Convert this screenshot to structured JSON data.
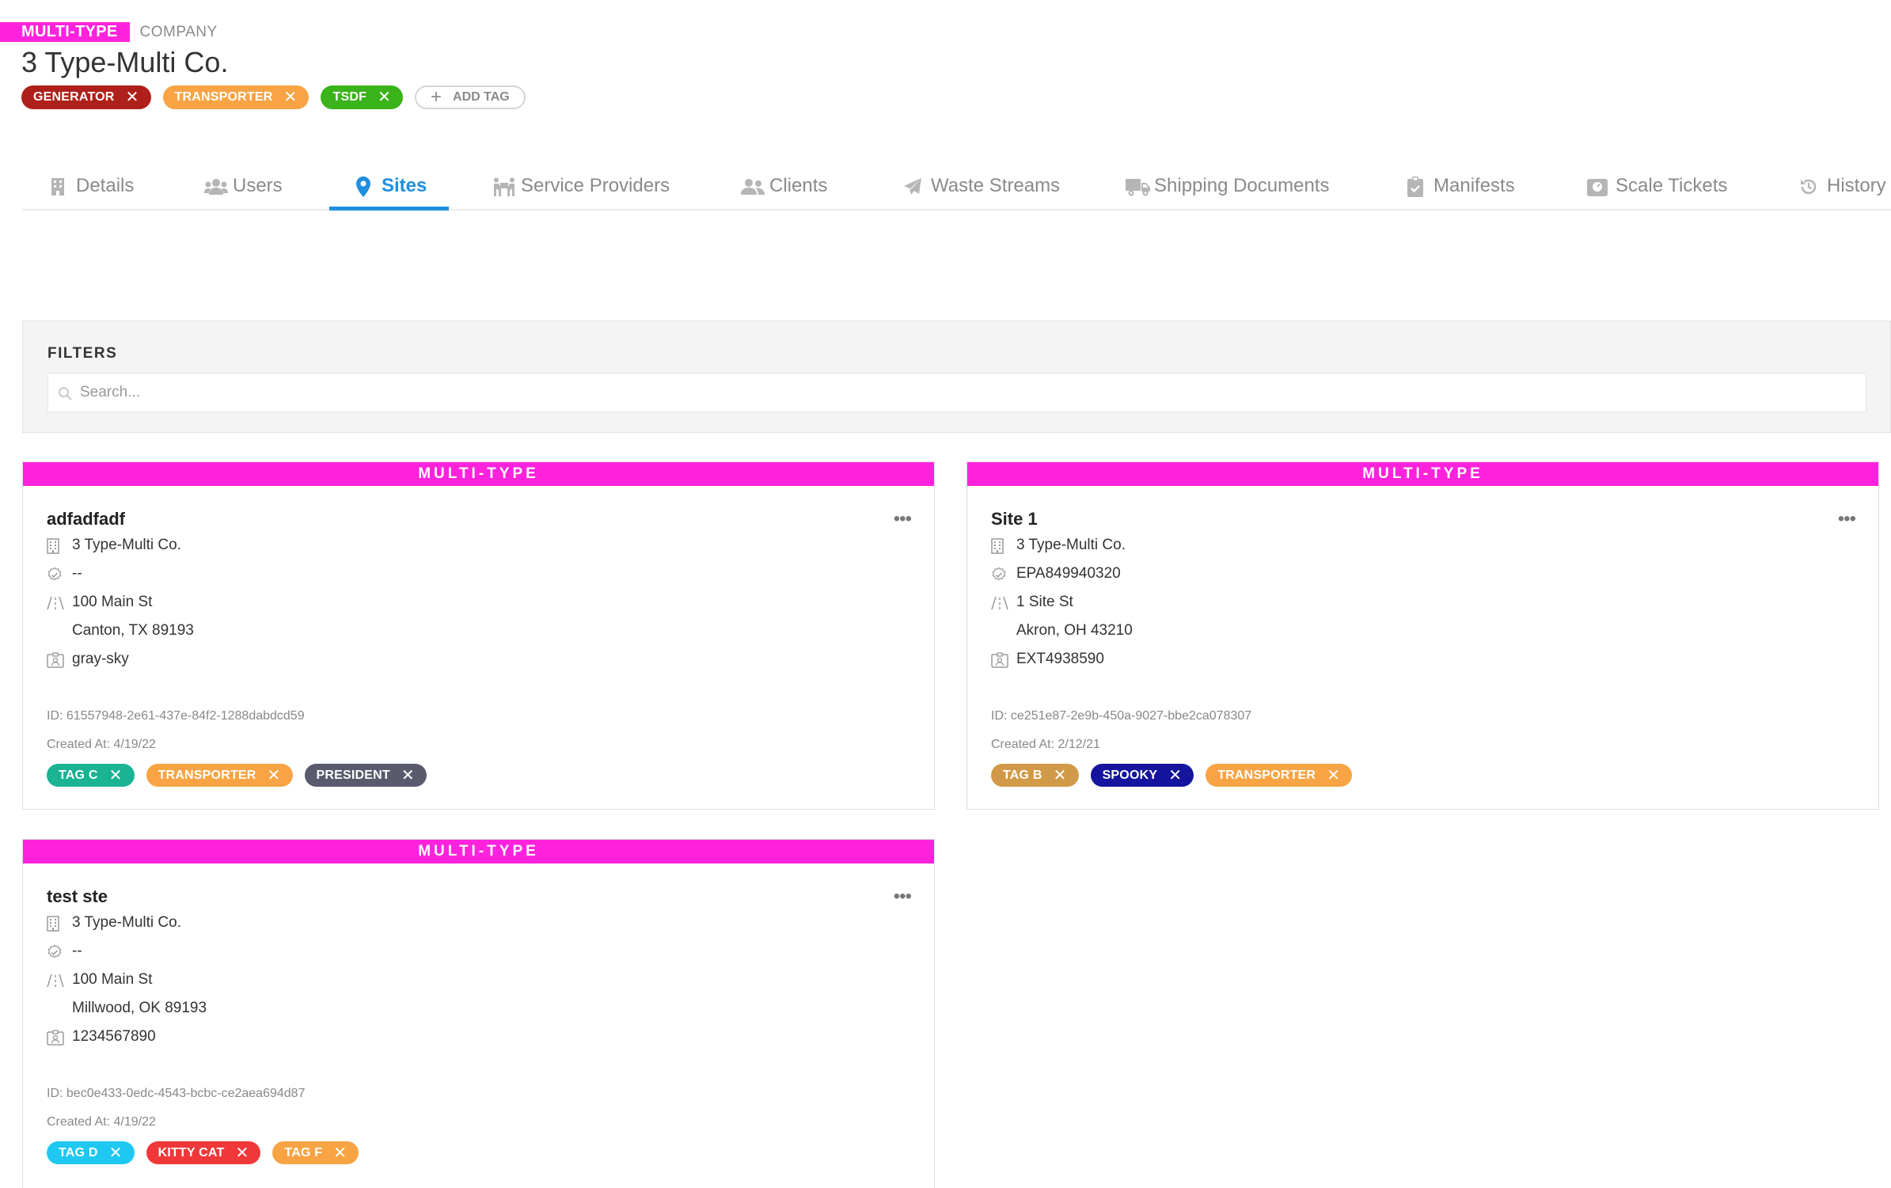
{
  "header": {
    "type_badge": "MULTI-TYPE",
    "entity_label": "COMPANY",
    "company_name": "3 Type-Multi Co.",
    "tags": [
      {
        "label": "GENERATOR",
        "color": "#b0201a"
      },
      {
        "label": "TRANSPORTER",
        "color": "#f8a444"
      },
      {
        "label": "TSDF",
        "color": "#3bb31a"
      }
    ],
    "add_tag_label": "ADD TAG"
  },
  "tabs": [
    {
      "label": "Details",
      "icon": "building-icon"
    },
    {
      "label": "Users",
      "icon": "users-icon"
    },
    {
      "label": "Sites",
      "icon": "map-marker-icon",
      "active": true
    },
    {
      "label": "Service Providers",
      "icon": "people-carry-icon"
    },
    {
      "label": "Clients",
      "icon": "user-friends-icon"
    },
    {
      "label": "Waste Streams",
      "icon": "paper-plane-icon"
    },
    {
      "label": "Shipping Documents",
      "icon": "truck-icon"
    },
    {
      "label": "Manifests",
      "icon": "clipboard-check-icon"
    },
    {
      "label": "Scale Tickets",
      "icon": "scale-icon"
    },
    {
      "label": "History",
      "icon": "history-icon"
    }
  ],
  "filters": {
    "title": "FILTERS",
    "search_placeholder": "Search..."
  },
  "colors": {
    "accent": "#ff22dd",
    "active_tab": "#1f8fe0"
  },
  "sites": [
    {
      "type": "MULTI-TYPE",
      "name": "adfadfadf",
      "company": "3 Type-Multi Co.",
      "epa_id": "--",
      "address_line1": "100 Main St",
      "address_line2": "Canton, TX 89193",
      "external_id": "gray-sky",
      "id_text": "ID: 61557948-2e61-437e-84f2-1288dabdcd59",
      "created_text": "Created At: 4/19/22",
      "tags": [
        {
          "label": "TAG C",
          "color": "#1ab394"
        },
        {
          "label": "TRANSPORTER",
          "color": "#f8a444"
        },
        {
          "label": "PRESIDENT",
          "color": "#5a5a6e"
        }
      ]
    },
    {
      "type": "MULTI-TYPE",
      "name": "Site 1",
      "company": "3 Type-Multi Co.",
      "epa_id": "EPA849940320",
      "address_line1": "1 Site St",
      "address_line2": "Akron, OH 43210",
      "external_id": "EXT4938590",
      "id_text": "ID: ce251e87-2e9b-450a-9027-bbe2ca078307",
      "created_text": "Created At: 2/12/21",
      "tags": [
        {
          "label": "TAG B",
          "color": "#d09a48"
        },
        {
          "label": "SPOOKY",
          "color": "#14149e"
        },
        {
          "label": "TRANSPORTER",
          "color": "#f8a444"
        }
      ]
    },
    {
      "type": "MULTI-TYPE",
      "name": "test ste",
      "company": "3 Type-Multi Co.",
      "epa_id": "--",
      "address_line1": "100 Main St",
      "address_line2": "Millwood, OK 89193",
      "external_id": "1234567890",
      "id_text": "ID: bec0e433-0edc-4543-bcbc-ce2aea694d87",
      "created_text": "Created At: 4/19/22",
      "tags": [
        {
          "label": "TAG D",
          "color": "#1ec8f0"
        },
        {
          "label": "KITTY CAT",
          "color": "#f0383a"
        },
        {
          "label": "TAG F",
          "color": "#f8a444"
        }
      ]
    }
  ]
}
